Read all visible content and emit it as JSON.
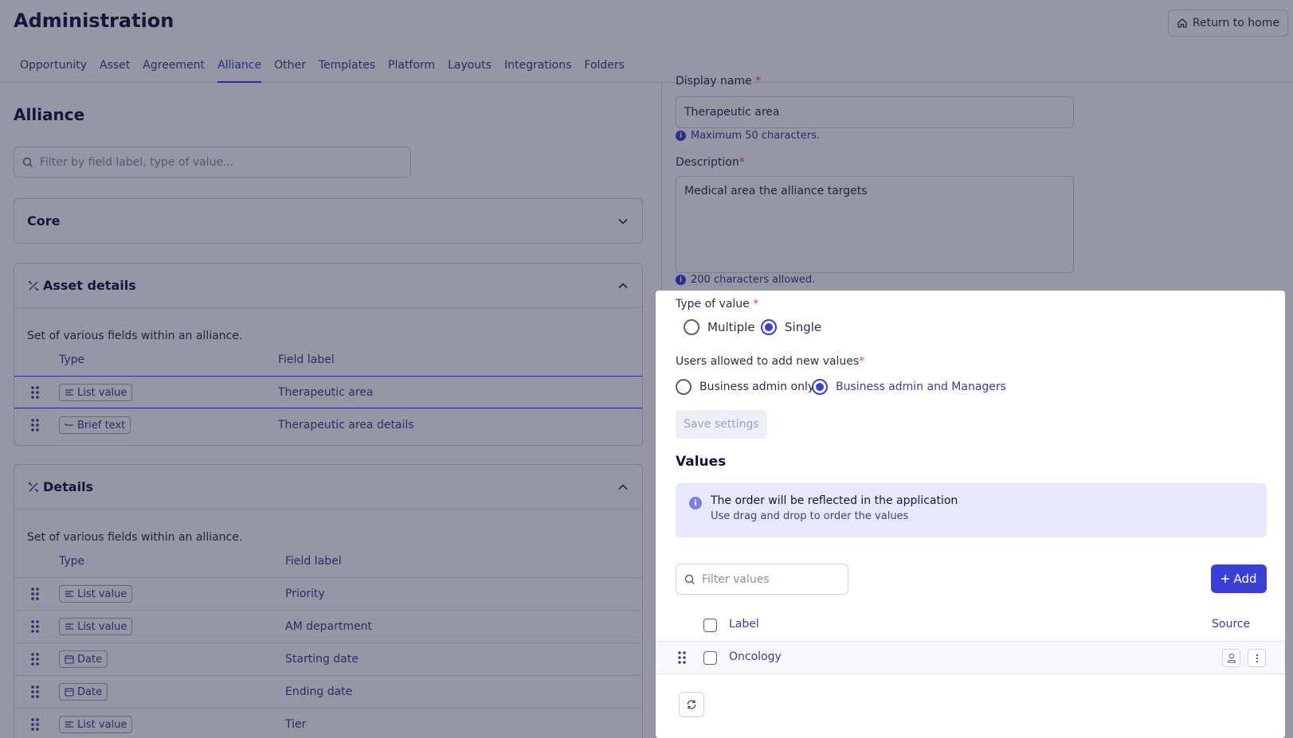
{
  "app": {
    "title": "Administration",
    "return_home": "Return to home"
  },
  "tabs": [
    {
      "label": "Opportunity"
    },
    {
      "label": "Asset"
    },
    {
      "label": "Agreement"
    },
    {
      "label": "Alliance",
      "active": true
    },
    {
      "label": "Other"
    },
    {
      "label": "Templates"
    },
    {
      "label": "Platform"
    },
    {
      "label": "Layouts"
    },
    {
      "label": "Integrations"
    },
    {
      "label": "Folders"
    }
  ],
  "left": {
    "title": "Alliance",
    "search_placeholder": "Filter by field label, type of value...",
    "core": {
      "title": "Core"
    },
    "asset_details": {
      "title": "Asset details",
      "description": "Set of various fields within an alliance.",
      "col_type": "Type",
      "col_label": "Field label",
      "rows": [
        {
          "type": "List value",
          "label": "Therapeutic area"
        },
        {
          "type": "Brief text",
          "label": "Therapeutic area details"
        }
      ]
    },
    "details": {
      "title": "Details",
      "description": "Set of various fields within an alliance.",
      "col_type": "Type",
      "col_label": "Field label",
      "rows": [
        {
          "type": "List value",
          "label": "Priority"
        },
        {
          "type": "List value",
          "label": "AM department"
        },
        {
          "type": "Date",
          "label": "Starting date"
        },
        {
          "type": "Date",
          "label": "Ending date"
        },
        {
          "type": "List value",
          "label": "Tier"
        }
      ]
    }
  },
  "right": {
    "display_name_label": "Display name",
    "display_name_value": "Therapeutic area",
    "display_name_hint": "Maximum 50 characters.",
    "description_label": "Description",
    "description_value": "Medical area the alliance targets",
    "description_hint": "200 characters allowed.",
    "type_of_value_label": "Type of value",
    "type_options": {
      "multiple": "Multiple",
      "single": "Single",
      "selected": "Single"
    },
    "users_label": "Users allowed to add new values",
    "user_options": {
      "admin_only": "Business admin only",
      "admin_managers": "Business admin and Managers",
      "selected": "Business admin and Managers"
    },
    "save_label": "Save settings",
    "values_title": "Values",
    "banner_title": "The order will be reflected in the application",
    "banner_text": "Use drag and drop to order the values",
    "filter_placeholder": "Filter values",
    "add_label": "Add",
    "col_label": "Label",
    "col_source": "Source",
    "values": [
      {
        "label": "Oncology"
      }
    ],
    "required_mark": "*"
  },
  "colors": {
    "accent": "#3b3fd8",
    "required": "#e5484d",
    "overlay": "rgba(20,24,56,0.45)"
  }
}
